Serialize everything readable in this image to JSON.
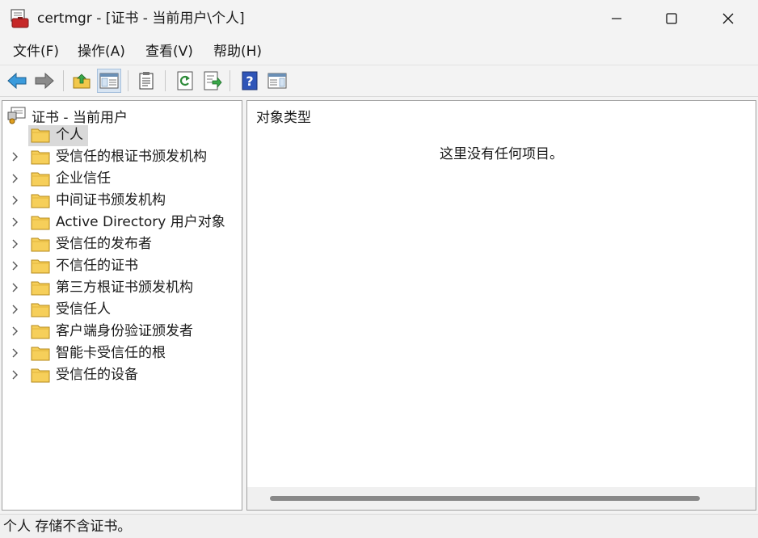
{
  "window": {
    "title": "certmgr - [证书 - 当前用户\\个人]"
  },
  "menu": [
    {
      "label": "文件(F)"
    },
    {
      "label": "操作(A)"
    },
    {
      "label": "查看(V)"
    },
    {
      "label": "帮助(H)"
    }
  ],
  "toolbar": {
    "buttons": [
      {
        "icon": "back-arrow-icon"
      },
      {
        "icon": "forward-arrow-icon"
      },
      {
        "icon": "up-folder-icon"
      },
      {
        "icon": "show-hide-console-tree-icon",
        "active": true
      },
      {
        "icon": "properties-icon"
      },
      {
        "icon": "refresh-icon"
      },
      {
        "icon": "export-list-icon"
      },
      {
        "icon": "help-icon"
      },
      {
        "icon": "show-hide-action-pane-icon"
      }
    ]
  },
  "tree": {
    "root_label": "证书 - 当前用户",
    "items": [
      {
        "label": "个人",
        "selected": true
      },
      {
        "label": "受信任的根证书颁发机构"
      },
      {
        "label": "企业信任"
      },
      {
        "label": "中间证书颁发机构"
      },
      {
        "label": "Active Directory 用户对象"
      },
      {
        "label": "受信任的发布者"
      },
      {
        "label": "不信任的证书"
      },
      {
        "label": "第三方根证书颁发机构"
      },
      {
        "label": "受信任人"
      },
      {
        "label": "客户端身份验证颁发者"
      },
      {
        "label": "智能卡受信任的根"
      },
      {
        "label": "受信任的设备"
      }
    ]
  },
  "list": {
    "column_header": "对象类型",
    "empty_message": "这里没有任何项目。"
  },
  "status": {
    "text": "个人 存储不含证书。"
  }
}
